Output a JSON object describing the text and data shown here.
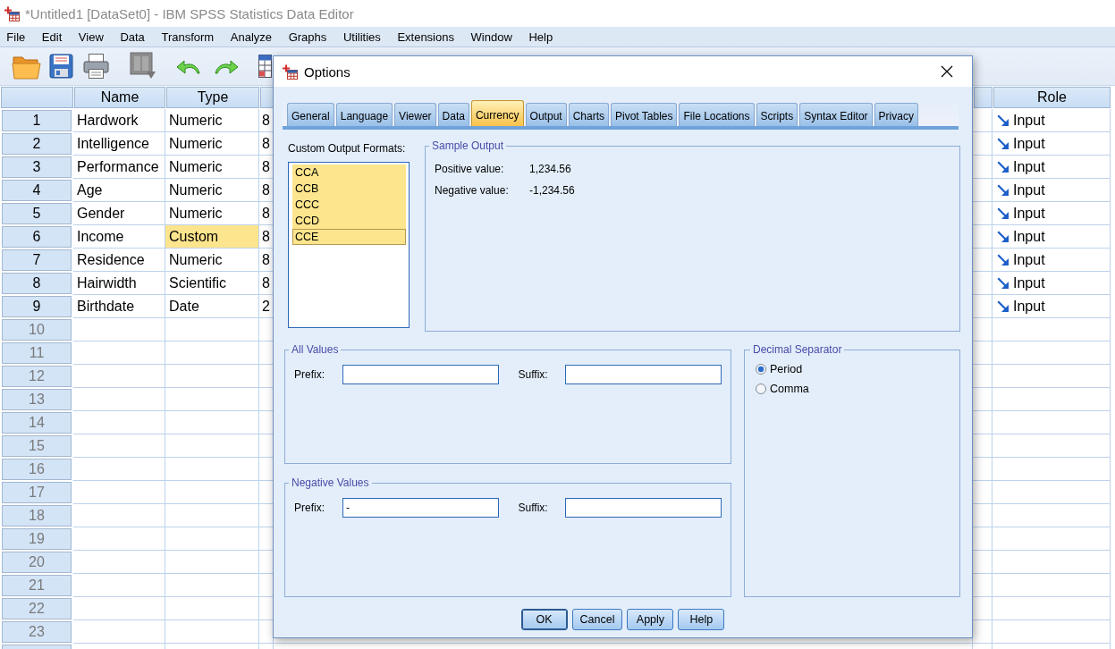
{
  "window": {
    "title": "*Untitled1 [DataSet0] - IBM SPSS Statistics Data Editor",
    "active": false
  },
  "menu": [
    {
      "label": "File"
    },
    {
      "label": "Edit"
    },
    {
      "label": "View"
    },
    {
      "label": "Data"
    },
    {
      "label": "Transform"
    },
    {
      "label": "Analyze"
    },
    {
      "label": "Graphs"
    },
    {
      "label": "Utilities"
    },
    {
      "label": "Extensions"
    },
    {
      "label": "Window"
    },
    {
      "label": "Help"
    }
  ],
  "grid": {
    "columns": {
      "name": "Name",
      "type": "Type",
      "role": "Role"
    },
    "rows": [
      {
        "number": "1",
        "empty": false,
        "name": "Hardwork",
        "type": "Numeric",
        "type_selected": false,
        "column_3": "8",
        "role": "Input"
      },
      {
        "number": "2",
        "empty": false,
        "name": "Intelligence",
        "type": "Numeric",
        "type_selected": false,
        "column_3": "8",
        "role": "Input"
      },
      {
        "number": "3",
        "empty": false,
        "name": "Performance",
        "type": "Numeric",
        "type_selected": false,
        "column_3": "8",
        "role": "Input"
      },
      {
        "number": "4",
        "empty": false,
        "name": "Age",
        "type": "Numeric",
        "type_selected": false,
        "column_3": "8",
        "role": "Input"
      },
      {
        "number": "5",
        "empty": false,
        "name": "Gender",
        "type": "Numeric",
        "type_selected": false,
        "column_3": "8",
        "role": "Input"
      },
      {
        "number": "6",
        "empty": false,
        "name": "Income",
        "type": "Custom",
        "type_selected": true,
        "column_3": "8",
        "role": "Input"
      },
      {
        "number": "7",
        "empty": false,
        "name": "Residence",
        "type": "Numeric",
        "type_selected": false,
        "column_3": "8",
        "role": "Input"
      },
      {
        "number": "8",
        "empty": false,
        "name": "Hairwidth",
        "type": "Scientific",
        "type_selected": false,
        "column_3": "8",
        "role": "Input"
      },
      {
        "number": "9",
        "empty": false,
        "name": "Birthdate",
        "type": "Date",
        "type_selected": false,
        "column_3": "2",
        "role": "Input"
      },
      {
        "number": "10",
        "empty": true
      },
      {
        "number": "11",
        "empty": true
      },
      {
        "number": "12",
        "empty": true
      },
      {
        "number": "13",
        "empty": true
      },
      {
        "number": "14",
        "empty": true
      },
      {
        "number": "15",
        "empty": true
      },
      {
        "number": "16",
        "empty": true
      },
      {
        "number": "17",
        "empty": true
      },
      {
        "number": "18",
        "empty": true
      },
      {
        "number": "19",
        "empty": true
      },
      {
        "number": "20",
        "empty": true
      },
      {
        "number": "21",
        "empty": true
      },
      {
        "number": "22",
        "empty": true
      },
      {
        "number": "23",
        "empty": true
      }
    ]
  },
  "dialog": {
    "title": "Options",
    "tabs": [
      {
        "label": "General",
        "selected": false
      },
      {
        "label": "Language",
        "selected": false
      },
      {
        "label": "Viewer",
        "selected": false
      },
      {
        "label": "Data",
        "selected": false
      },
      {
        "label": "Currency",
        "selected": true
      },
      {
        "label": "Output",
        "selected": false
      },
      {
        "label": "Charts",
        "selected": false
      },
      {
        "label": "Pivot Tables",
        "selected": false
      },
      {
        "label": "File Locations",
        "selected": false
      },
      {
        "label": "Scripts",
        "selected": false
      },
      {
        "label": "Syntax Editor",
        "selected": false
      },
      {
        "label": "Privacy",
        "selected": false
      }
    ],
    "formats": {
      "label": "Custom Output Formats:",
      "items": [
        {
          "label": "CCA",
          "selected": true,
          "focused": false
        },
        {
          "label": "CCB",
          "selected": true,
          "focused": false
        },
        {
          "label": "CCC",
          "selected": true,
          "focused": false
        },
        {
          "label": "CCD",
          "selected": true,
          "focused": false
        },
        {
          "label": "CCE",
          "selected": true,
          "focused": true
        }
      ]
    },
    "sample_output": {
      "title": "Sample Output",
      "rows": [
        {
          "label": "Positive value:",
          "value": "1,234.56"
        },
        {
          "label": "Negative value:",
          "value": "-1,234.56"
        }
      ]
    },
    "all_values": {
      "title": "All Values",
      "fields": [
        {
          "label": "Prefix:"
        },
        {
          "label": "Suffix:"
        }
      ]
    },
    "negative_values": {
      "title": "Negative Values",
      "fields": [
        {
          "label": "Prefix:",
          "value": "-"
        },
        {
          "label": "Suffix:"
        }
      ]
    },
    "decimal_separator": {
      "title": "Decimal Separator",
      "options": [
        {
          "label": "Period",
          "selected": true
        },
        {
          "label": "Comma",
          "selected": false
        }
      ]
    },
    "buttons": [
      {
        "label": "OK",
        "default": true
      },
      {
        "label": "Cancel",
        "default": false
      },
      {
        "label": "Apply",
        "default": false
      },
      {
        "label": "Help",
        "default": false
      }
    ]
  }
}
